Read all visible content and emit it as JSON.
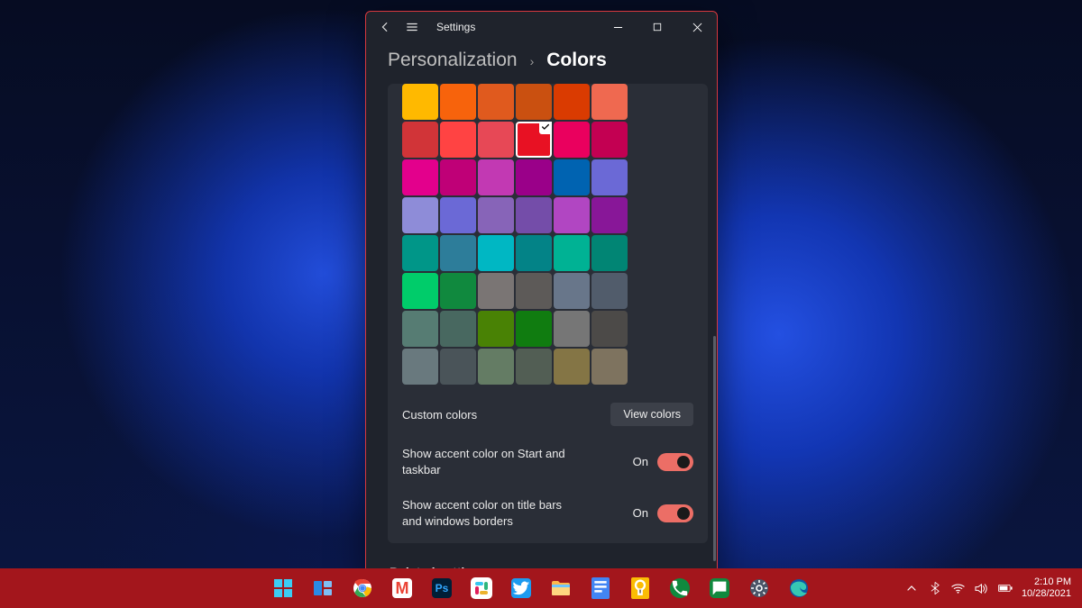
{
  "window": {
    "title": "Settings",
    "breadcrumb_parent": "Personalization",
    "breadcrumb_sep": "›",
    "breadcrumb_current": "Colors"
  },
  "colors": {
    "grid": [
      [
        "#FFB900",
        "#F7630C",
        "#E05A1E",
        "#CA5010",
        "#DA3B01",
        "#EF6950"
      ],
      [
        "#D13438",
        "#FF4343",
        "#E74856",
        "#E81123",
        "#EA005E",
        "#C30052"
      ],
      [
        "#E3008C",
        "#BF0077",
        "#C239B3",
        "#9A0089",
        "#0063B1",
        "#6B69D6"
      ],
      [
        "#8E8CD8",
        "#6B69D6",
        "#8764B8",
        "#744DA9",
        "#B146C2",
        "#881798"
      ],
      [
        "#009688",
        "#2D7D9A",
        "#00B7C3",
        "#038387",
        "#00B294",
        "#018574"
      ],
      [
        "#00CC6A",
        "#10893E",
        "#7A7574",
        "#5D5A58",
        "#68768A",
        "#515C6B"
      ],
      [
        "#567C73",
        "#486860",
        "#498205",
        "#107C10",
        "#767676",
        "#4C4A48"
      ],
      [
        "#69797E",
        "#4A5459",
        "#647C64",
        "#525E54",
        "#847545",
        "#7E735F"
      ]
    ],
    "selected_index": [
      1,
      3
    ]
  },
  "custom_colors": {
    "label": "Custom colors",
    "button": "View colors"
  },
  "options": [
    {
      "label": "Show accent color on Start and taskbar",
      "state": "On",
      "on": true
    },
    {
      "label": "Show accent color on title bars and windows borders",
      "state": "On",
      "on": true
    }
  ],
  "related_header": "Related settings",
  "taskbar": {
    "apps": [
      {
        "name": "start",
        "title": "Start"
      },
      {
        "name": "taskview",
        "title": "Task View"
      },
      {
        "name": "chrome",
        "title": "Google Chrome"
      },
      {
        "name": "gmail",
        "title": "Gmail"
      },
      {
        "name": "photoshop",
        "title": "Photoshop"
      },
      {
        "name": "slack",
        "title": "Slack"
      },
      {
        "name": "twitter",
        "title": "Twitter"
      },
      {
        "name": "explorer",
        "title": "File Explorer"
      },
      {
        "name": "docs",
        "title": "Google Docs"
      },
      {
        "name": "keep",
        "title": "Google Keep"
      },
      {
        "name": "phone",
        "title": "Phone"
      },
      {
        "name": "messages",
        "title": "Messages"
      },
      {
        "name": "settings",
        "title": "Settings"
      },
      {
        "name": "edge",
        "title": "Microsoft Edge"
      }
    ]
  },
  "tray": {
    "time": "2:10 PM",
    "date": "10/28/2021"
  }
}
